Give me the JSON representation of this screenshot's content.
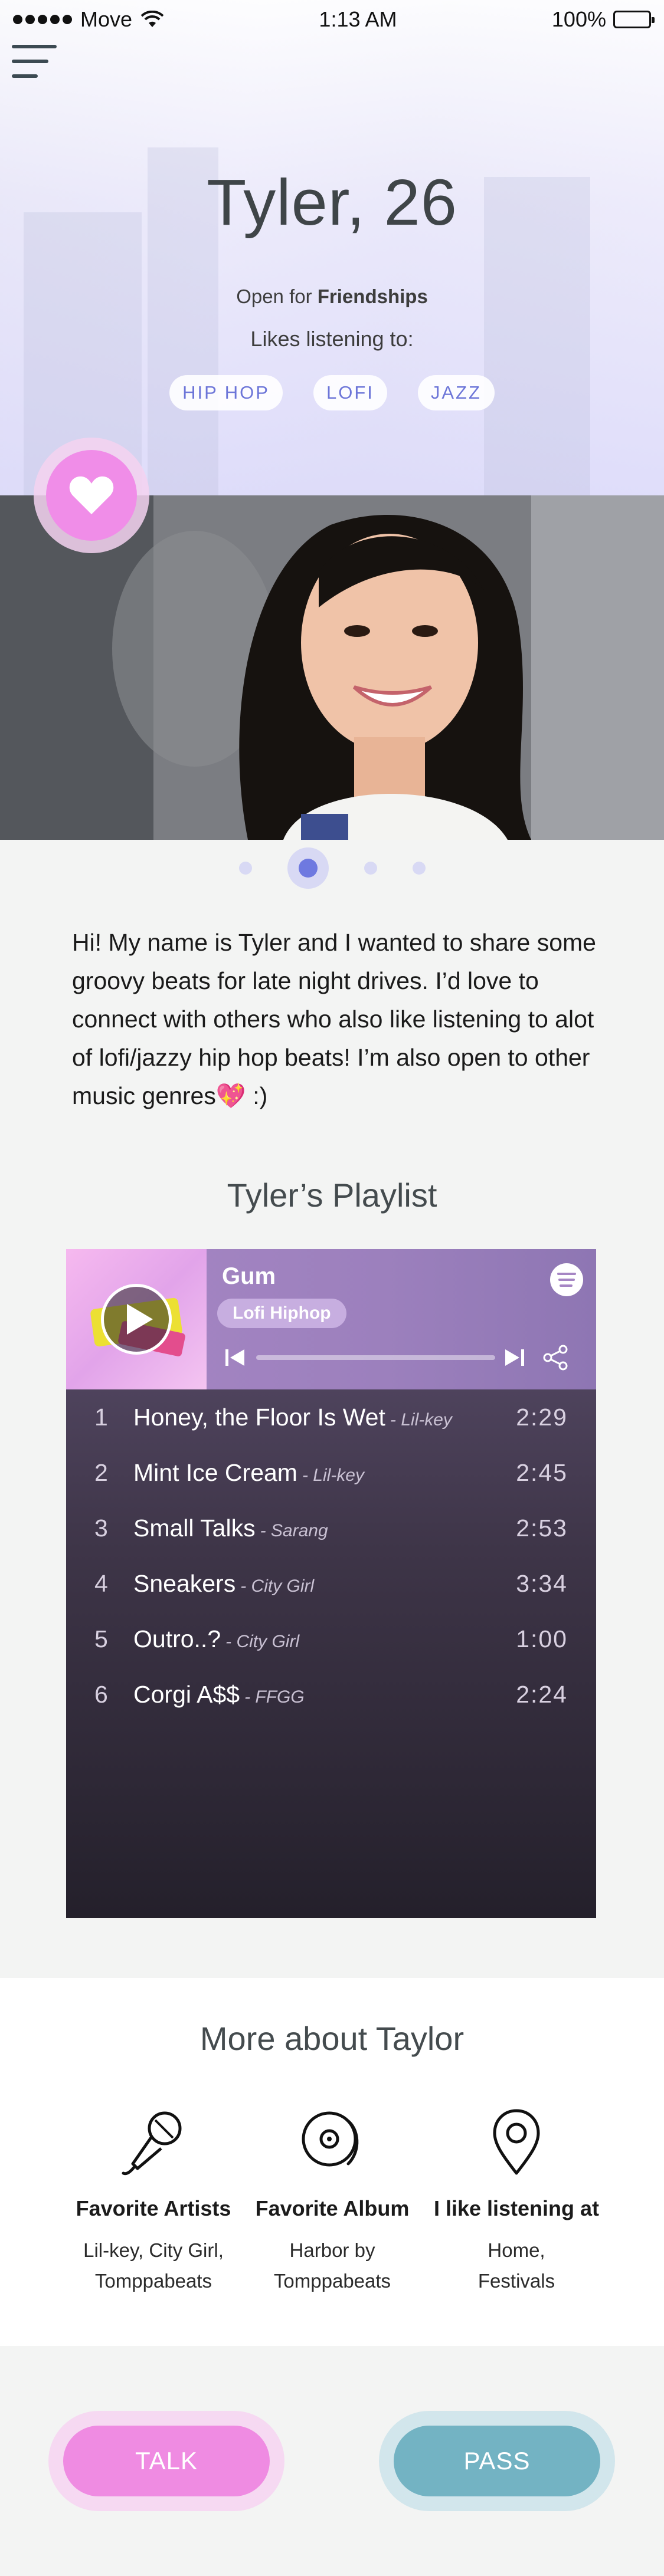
{
  "status_bar": {
    "carrier": "Move",
    "time": "1:13 AM",
    "battery": "100%"
  },
  "profile": {
    "name_age": "Tyler, 26",
    "open_for_prefix": "Open for ",
    "open_for_value": "Friendships",
    "likes_label": "Likes listening to:",
    "genres": [
      "HIP HOP",
      "LOFI",
      "JAZZ"
    ]
  },
  "gallery": {
    "page_count": 4,
    "active_page": 2
  },
  "bio": {
    "text": "Hi! My name is Tyler and I wanted to share some groovy beats for late night drives. I’d love to connect with others who also like listening to alot of lofi/jazzy hip hop beats! I’m also open to other music genres",
    "emoji": "💖",
    "suffix": " :)"
  },
  "playlist": {
    "title": "Tyler’s Playlist",
    "now_playing": {
      "track": "Gum",
      "tag": "Lofi Hiphop",
      "progress": 0.0
    },
    "tracks": [
      {
        "num": "1",
        "title": "Honey, the Floor Is Wet",
        "artist": "- Lil-key",
        "duration": "2:29"
      },
      {
        "num": "2",
        "title": "Mint Ice Cream",
        "artist": "- Lil-key",
        "duration": "2:45"
      },
      {
        "num": "3",
        "title": "Small Talks",
        "artist": "- Sarang",
        "duration": "2:53"
      },
      {
        "num": "4",
        "title": "Sneakers",
        "artist": "- City Girl",
        "duration": "3:34"
      },
      {
        "num": "5",
        "title": "Outro..?",
        "artist": "- City Girl",
        "duration": "1:00"
      },
      {
        "num": "6",
        "title": "Corgi A$$",
        "artist": "- FFGG",
        "duration": "2:24"
      }
    ]
  },
  "more_about": {
    "title": "More about Taylor",
    "features": [
      {
        "icon": "microphone-icon",
        "title": "Favorite Artists",
        "value_line1": "Lil-key, City Girl,",
        "value_line2": "Tomppabeats"
      },
      {
        "icon": "vinyl-record-icon",
        "title": "Favorite Album",
        "value_line1": "Harbor by",
        "value_line2": "Tomppabeats"
      },
      {
        "icon": "location-pin-icon",
        "title": "I like listening at",
        "value_line1": "Home,",
        "value_line2": "Festivals"
      }
    ]
  },
  "actions": {
    "talk_label": "TALK",
    "pass_label": "PASS"
  },
  "colors": {
    "accent_pink": "#ef8be2",
    "accent_blue": "#6e79e0",
    "pass_teal": "#73b3c3"
  }
}
